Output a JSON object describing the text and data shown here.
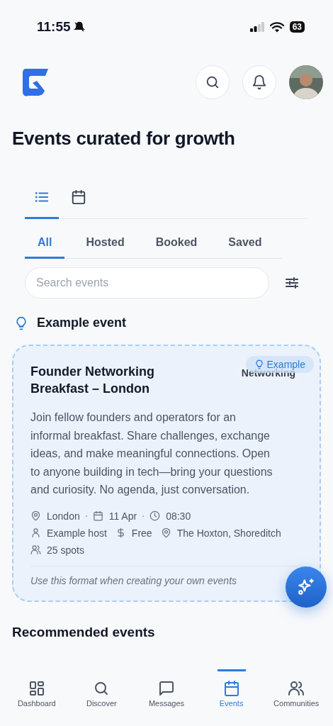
{
  "status_bar": {
    "time": "11:55",
    "battery": "63",
    "muted": true
  },
  "page_title": "Events curated for growth",
  "view_tabs": [
    {
      "kind": "list",
      "selected": true
    },
    {
      "kind": "calendar",
      "selected": false
    }
  ],
  "filter_tabs": [
    {
      "label": "All",
      "selected": true
    },
    {
      "label": "Hosted",
      "selected": false
    },
    {
      "label": "Booked",
      "selected": false
    },
    {
      "label": "Saved",
      "selected": false
    }
  ],
  "search": {
    "placeholder": "Search events"
  },
  "example_section": {
    "title": "Example event"
  },
  "event_card": {
    "title": "Founder Networking Breakfast – London",
    "tag": "Networking",
    "badge": "Example",
    "description": "Join fellow founders and operators for an informal breakfast. Share challenges, exchange ideas, and make meaningful connections. Open to anyone building in tech—bring your questions and curiosity. No agenda, just conversation.",
    "meta_rows": [
      {
        "separated": true,
        "items": [
          {
            "kind": "location",
            "text": "London"
          },
          {
            "kind": "calendar",
            "text": "11 Apr"
          },
          {
            "kind": "clock",
            "text": "08:30"
          }
        ]
      },
      {
        "separated": false,
        "items": [
          {
            "kind": "person",
            "text": "Example host"
          },
          {
            "kind": "dollar",
            "text": "Free"
          },
          {
            "kind": "location",
            "text": "The Hoxton, Shoreditch"
          }
        ]
      },
      {
        "items": [
          {
            "kind": "people",
            "text": "25 spots"
          }
        ]
      }
    ],
    "footer_note": "Use this format when creating your own events"
  },
  "next_section": {
    "title": "Recommended events"
  },
  "bottom_nav": [
    {
      "kind": "grid",
      "label": "Dashboard",
      "selected": false
    },
    {
      "kind": "search",
      "label": "Discover",
      "selected": false
    },
    {
      "kind": "chat",
      "label": "Messages",
      "selected": false
    },
    {
      "kind": "calendar",
      "label": "Events",
      "selected": true
    },
    {
      "kind": "people",
      "label": "Communities",
      "selected": false
    }
  ]
}
